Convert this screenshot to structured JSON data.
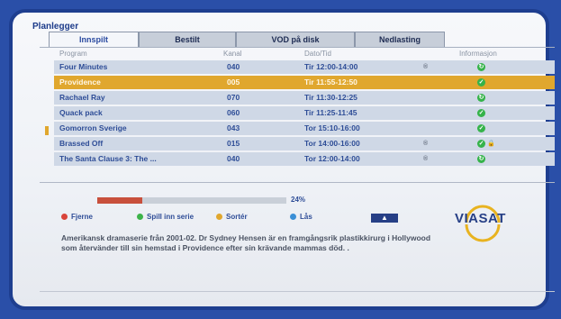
{
  "app_title": "Planlegger",
  "tabs": [
    {
      "label": "Innspilt",
      "active": true
    },
    {
      "label": "Bestilt",
      "active": false
    },
    {
      "label": "VOD på disk",
      "active": false
    },
    {
      "label": "Nedlasting",
      "active": false
    }
  ],
  "columns": {
    "program": "Program",
    "channel": "Kanal",
    "datetime": "Dato/Tid",
    "info": "Informasjon"
  },
  "rows": [
    {
      "program": "Four Minutes",
      "channel": "040",
      "datetime": "Tir 12:00-14:00",
      "rec": "®",
      "info_icon": "refresh-icon",
      "selected": false
    },
    {
      "program": "Providence",
      "channel": "005",
      "datetime": "Tir 11:55-12:50",
      "rec": "",
      "info_icon": "check-icon",
      "selected": true
    },
    {
      "program": "Rachael Ray",
      "channel": "070",
      "datetime": "Tir 11:30-12:25",
      "rec": "",
      "info_icon": "refresh-icon",
      "selected": false
    },
    {
      "program": "Quack pack",
      "channel": "060",
      "datetime": "Tir 11:25-11:45",
      "rec": "",
      "info_icon": "check-icon",
      "selected": false
    },
    {
      "program": "Gomorron Sverige",
      "channel": "043",
      "datetime": "Tor 15:10-16:00",
      "rec": "",
      "info_icon": "check-icon",
      "selected": false
    },
    {
      "program": "Brassed Off",
      "channel": "015",
      "datetime": "Tor 14:00-16:00",
      "rec": "®",
      "info_icon": "check-lock-icon",
      "selected": false
    },
    {
      "program": "The Santa Clause 3: The ...",
      "channel": "040",
      "datetime": "Tor 12:00-14:00",
      "rec": "®",
      "info_icon": "refresh-icon",
      "selected": false
    }
  ],
  "progress": {
    "percent_value": 24,
    "label": "24%"
  },
  "keys": {
    "red": {
      "label": "Fjerne",
      "color": "#d9443a"
    },
    "green": {
      "label": "Spill inn serie",
      "color": "#3db34a"
    },
    "yellow": {
      "label": "Sortér",
      "color": "#e0a72e"
    },
    "blue": {
      "label": "Lås",
      "color": "#3a8fd6"
    }
  },
  "logo": "VIASAT",
  "description": "Amerikansk dramaserie från 2001-02. Dr Sydney Hensen är en framgångsrik plastikkirurg i Hollywood som återvänder till sin hemstad i Providence efter sin krävande mammas död. ."
}
